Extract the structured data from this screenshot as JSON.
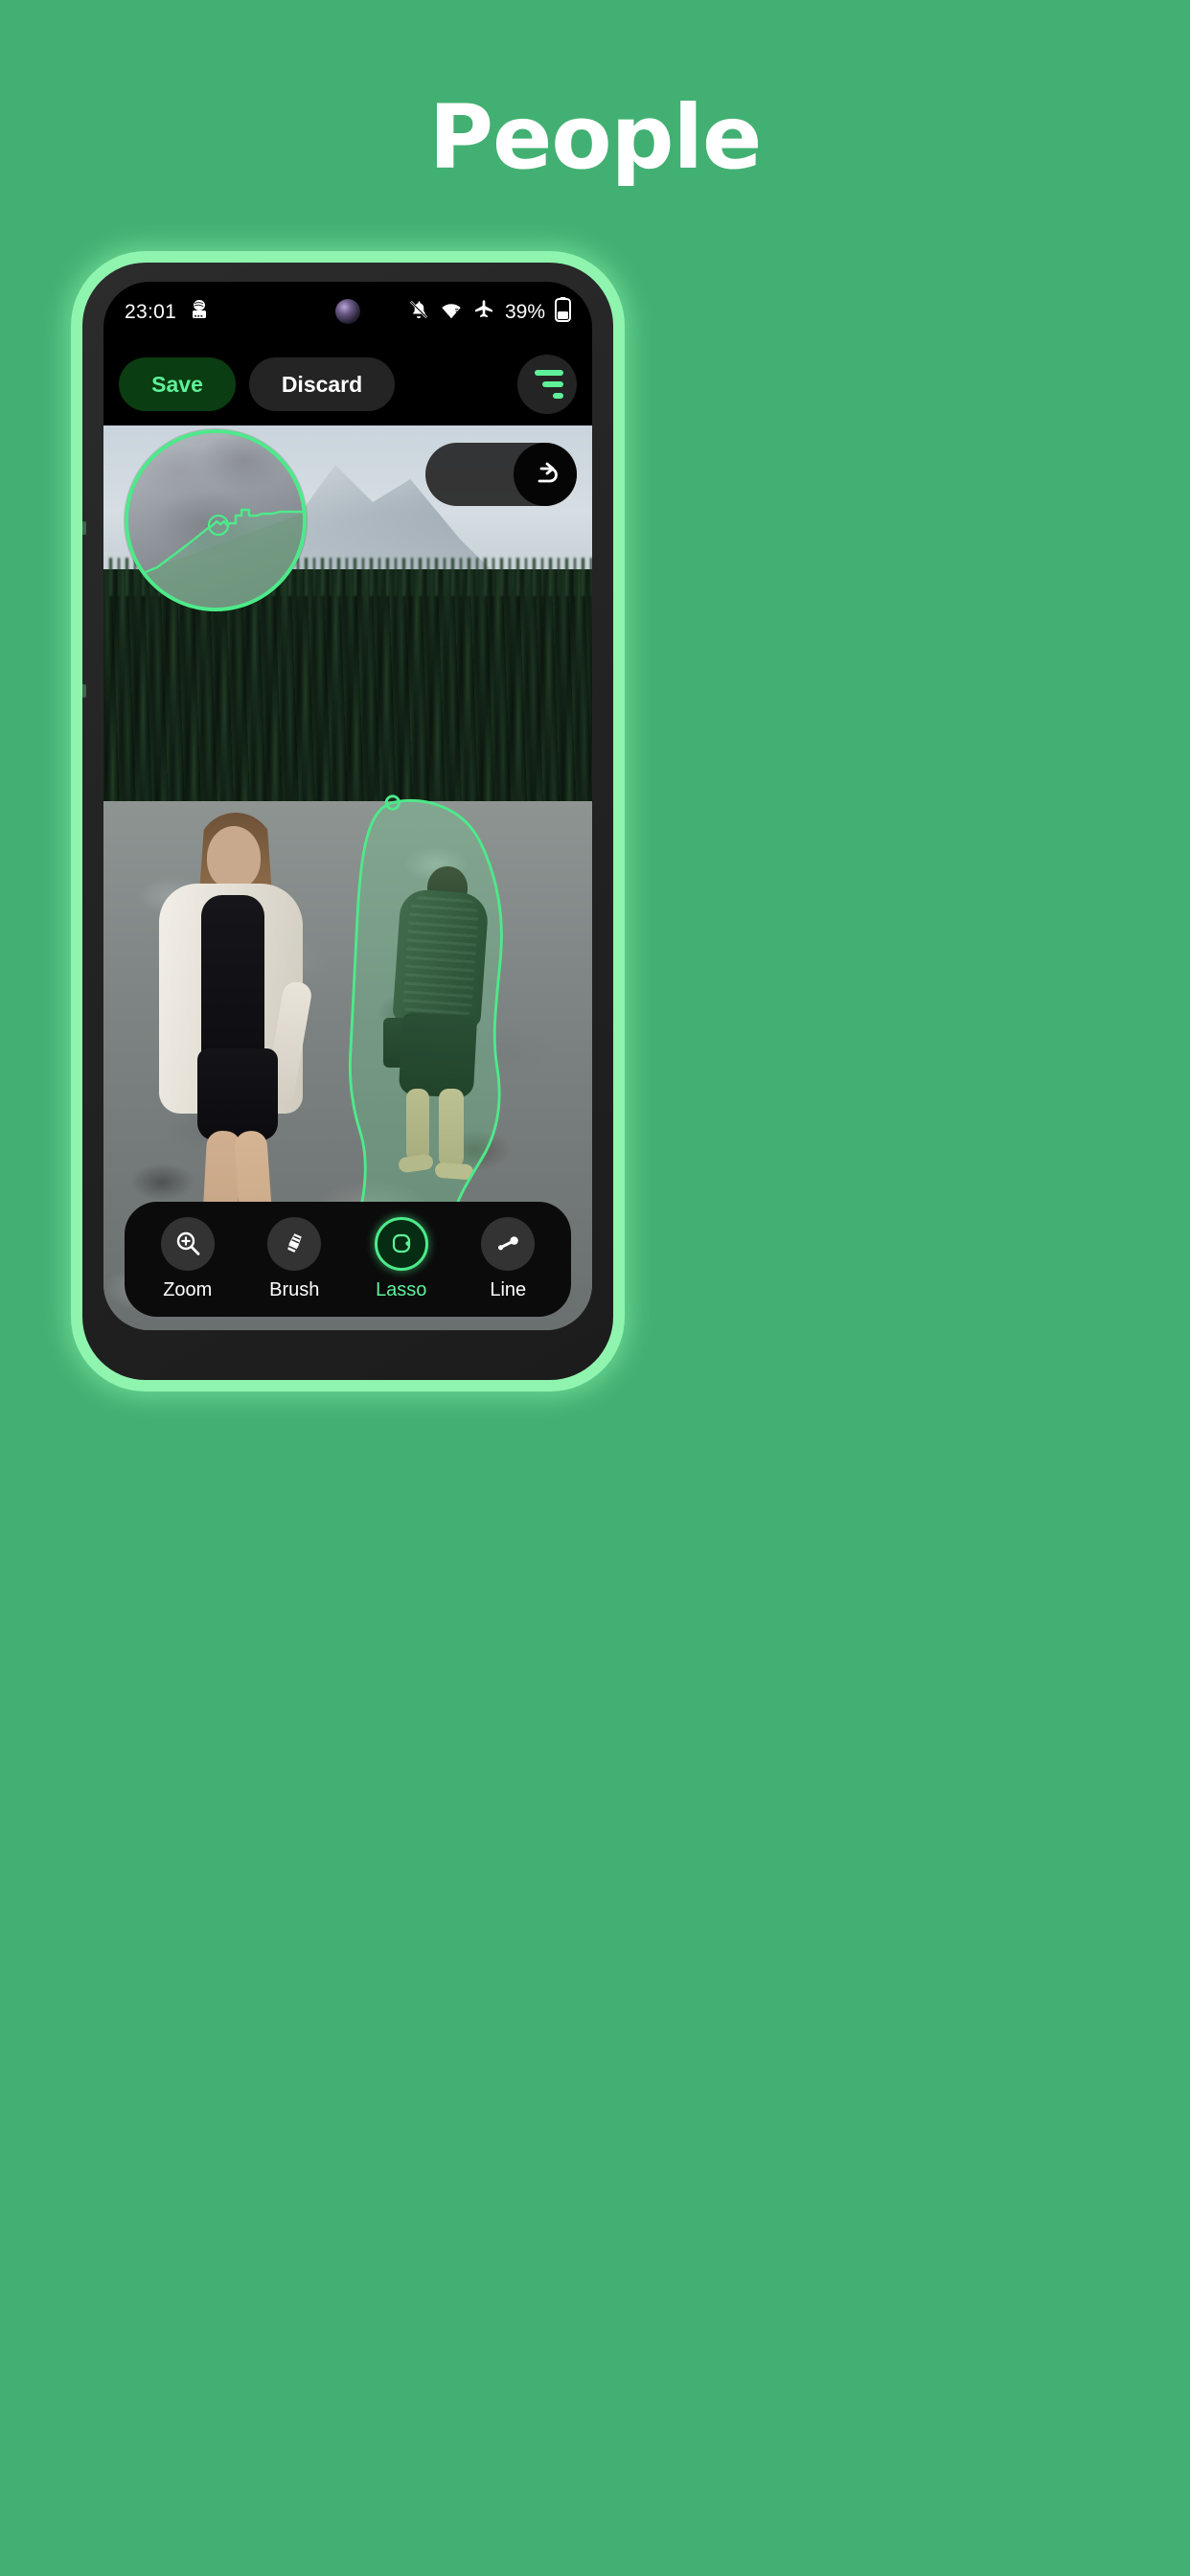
{
  "page": {
    "title": "People",
    "background_color": "#42b072",
    "title_color": "#ffffff"
  },
  "phone": {
    "frame_glow_color": "#8ff4ae",
    "bezel_color": "#262626"
  },
  "status_bar": {
    "time": "23:01",
    "left_icons": [
      "android-auto-icon"
    ],
    "right_icons": [
      "bell-off-icon",
      "wifi-icon",
      "airplane-mode-icon"
    ],
    "battery_percent": "39%",
    "battery_icon": "battery-icon",
    "camera_punch_hole": "front-camera-icon"
  },
  "action_bar": {
    "save_label": "Save",
    "save_bg": "#0b3d12",
    "save_fg": "#5ff09a",
    "discard_label": "Discard",
    "discard_bg": "#242424",
    "discard_fg": "#ffffff",
    "menu_icon": "tune-filter-icon",
    "menu_icon_color": "#5ff09a"
  },
  "canvas": {
    "history": {
      "undo_icon": "undo-arrow-icon",
      "redo_icon": "redo-arrow-icon",
      "undo_enabled": false,
      "redo_enabled": true
    },
    "magnifier": {
      "name": "magnifier-loupe",
      "border_color": "#4dea8a"
    },
    "selection": {
      "name": "lasso-selection-man",
      "stroke_color": "#4dea8a",
      "fill_color": "rgba(90,230,140,0.22)",
      "subject": "person"
    }
  },
  "toolbar": {
    "accent_color": "#5ff09a",
    "tools": [
      {
        "id": "zoom",
        "label": "Zoom",
        "icon": "magnifier-plus-icon",
        "active": false
      },
      {
        "id": "brush",
        "label": "Brush",
        "icon": "brush-icon",
        "active": false
      },
      {
        "id": "lasso",
        "label": "Lasso",
        "icon": "lasso-icon",
        "active": true
      },
      {
        "id": "line",
        "label": "Line",
        "icon": "line-tool-icon",
        "active": false
      }
    ]
  }
}
